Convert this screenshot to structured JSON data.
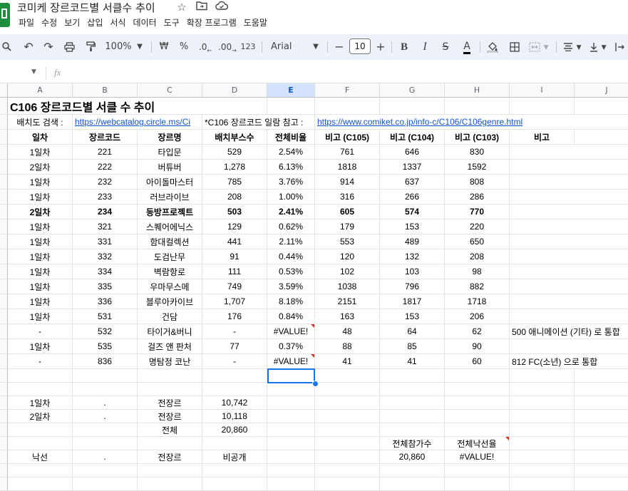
{
  "app": {
    "title": "코미케 장르코드별 서클수 추이",
    "menus": [
      "파일",
      "수정",
      "보기",
      "삽입",
      "서식",
      "데이터",
      "도구",
      "확장 프로그램",
      "도움말"
    ]
  },
  "toolbar": {
    "zoom": "100%",
    "currency": "₩",
    "percent": "%",
    "dec_decrease": ".0",
    "dec_increase": ".00",
    "number_format": "123",
    "font": "Arial",
    "font_size": "10"
  },
  "formula_bar": {
    "fx": "fx",
    "value": ""
  },
  "columns": [
    "A",
    "B",
    "C",
    "D",
    "E",
    "F",
    "G",
    "H",
    "I",
    "J"
  ],
  "selected_column": "E",
  "sheet": {
    "title": "C106 장르코드별 서클 수 추이",
    "search_label": "배치도 검색 :",
    "search_link": "https://webcatalog.circle.ms/Ci",
    "ref_label": "*C106 장르코드 일람 참고 :",
    "ref_link": "https://www.comiket.co.jp/info-c/C106/C106genre.html",
    "headers": [
      "일차",
      "장르코드",
      "장르명",
      "배치부스수",
      "전체비율",
      "비고 (C105)",
      "비고 (C104)",
      "비고 (C103)",
      "비고"
    ],
    "rows": [
      {
        "day": "1일차",
        "code": "221",
        "name": "타입문",
        "booths": "529",
        "ratio": "2.54%",
        "c105": "761",
        "c104": "646",
        "c103": "830",
        "note": ""
      },
      {
        "day": "2일차",
        "code": "222",
        "name": "버튜버",
        "booths": "1,278",
        "ratio": "6.13%",
        "c105": "1818",
        "c104": "1337",
        "c103": "1592",
        "note": ""
      },
      {
        "day": "1일차",
        "code": "232",
        "name": "아이돌마스터",
        "booths": "785",
        "ratio": "3.76%",
        "c105": "914",
        "c104": "637",
        "c103": "808",
        "note": ""
      },
      {
        "day": "1일차",
        "code": "233",
        "name": "러브라이브",
        "booths": "208",
        "ratio": "1.00%",
        "c105": "316",
        "c104": "266",
        "c103": "286",
        "note": ""
      },
      {
        "day": "2일차",
        "code": "234",
        "name": "동방프로젝트",
        "booths": "503",
        "ratio": "2.41%",
        "c105": "605",
        "c104": "574",
        "c103": "770",
        "note": "",
        "bold": true
      },
      {
        "day": "1일차",
        "code": "321",
        "name": "스퀘어에닉스",
        "booths": "129",
        "ratio": "0.62%",
        "c105": "179",
        "c104": "153",
        "c103": "220",
        "note": ""
      },
      {
        "day": "1일차",
        "code": "331",
        "name": "함대컬렉션",
        "booths": "441",
        "ratio": "2.11%",
        "c105": "553",
        "c104": "489",
        "c103": "650",
        "note": ""
      },
      {
        "day": "1일차",
        "code": "332",
        "name": "도검난무",
        "booths": "91",
        "ratio": "0.44%",
        "c105": "120",
        "c104": "132",
        "c103": "208",
        "note": ""
      },
      {
        "day": "1일차",
        "code": "334",
        "name": "벽람항로",
        "booths": "111",
        "ratio": "0.53%",
        "c105": "102",
        "c104": "103",
        "c103": "98",
        "note": ""
      },
      {
        "day": "1일차",
        "code": "335",
        "name": "우마무스메",
        "booths": "749",
        "ratio": "3.59%",
        "c105": "1038",
        "c104": "796",
        "c103": "882",
        "note": ""
      },
      {
        "day": "1일차",
        "code": "336",
        "name": "블루아카이브",
        "booths": "1,707",
        "ratio": "8.18%",
        "c105": "2151",
        "c104": "1817",
        "c103": "1718",
        "note": ""
      },
      {
        "day": "1일차",
        "code": "531",
        "name": "건담",
        "booths": "176",
        "ratio": "0.84%",
        "c105": "163",
        "c104": "153",
        "c103": "206",
        "note": ""
      },
      {
        "day": "-",
        "code": "532",
        "name": "타이거&버니",
        "booths": "-",
        "ratio": "#VALUE!",
        "c105": "48",
        "c104": "64",
        "c103": "62",
        "note": "500 애니메이션 (기타) 로 통합",
        "err": true
      },
      {
        "day": "1일차",
        "code": "535",
        "name": "걸즈 앤 판처",
        "booths": "77",
        "ratio": "0.37%",
        "c105": "88",
        "c104": "85",
        "c103": "90",
        "note": ""
      },
      {
        "day": "-",
        "code": "836",
        "name": "명탐정 코난",
        "booths": "-",
        "ratio": "#VALUE!",
        "c105": "41",
        "c104": "41",
        "c103": "60",
        "note": "812 FC(소년) 으로 통합",
        "err": true
      }
    ],
    "summary": [
      {
        "a": "1일차",
        "b": ".",
        "c": "전장르",
        "d": "10,742"
      },
      {
        "a": "2일차",
        "b": ".",
        "c": "전장르",
        "d": "10,118"
      },
      {
        "a": "",
        "b": "",
        "c": "전체",
        "d": "20,860"
      }
    ],
    "total_participants_label": "전체참가수",
    "total_fail_rate_label": "전체낙선율",
    "fail_row": {
      "a": "낙선",
      "b": ".",
      "c": "전장르",
      "d": "비공개",
      "g": "20,860",
      "h": "#VALUE!"
    }
  }
}
